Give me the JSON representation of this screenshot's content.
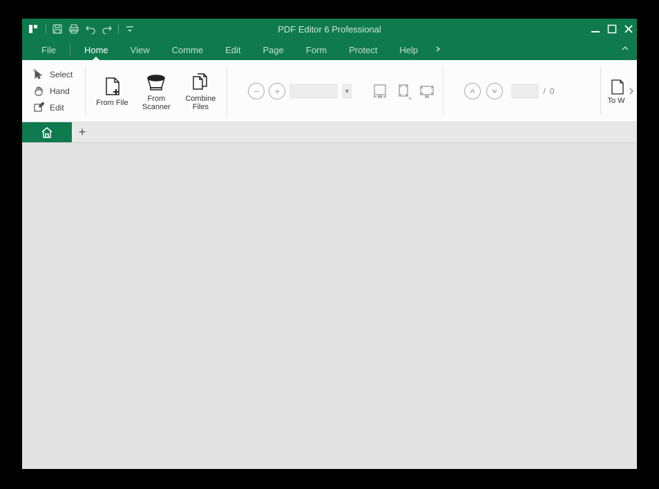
{
  "app": {
    "title": "PDF Editor 6 Professional"
  },
  "menu": {
    "file": "File",
    "home": "Home",
    "view": "View",
    "comment": "Comme",
    "edit": "Edit",
    "page": "Page",
    "form": "Form",
    "protect": "Protect",
    "help": "Help"
  },
  "tools": {
    "select": "Select",
    "hand": "Hand",
    "edit": "Edit"
  },
  "ribbon": {
    "from_file": "From File",
    "from_scanner": "From Scanner",
    "combine_files": "Combine Files",
    "to_word": "To W"
  },
  "page": {
    "sep": "/",
    "total": "0"
  }
}
